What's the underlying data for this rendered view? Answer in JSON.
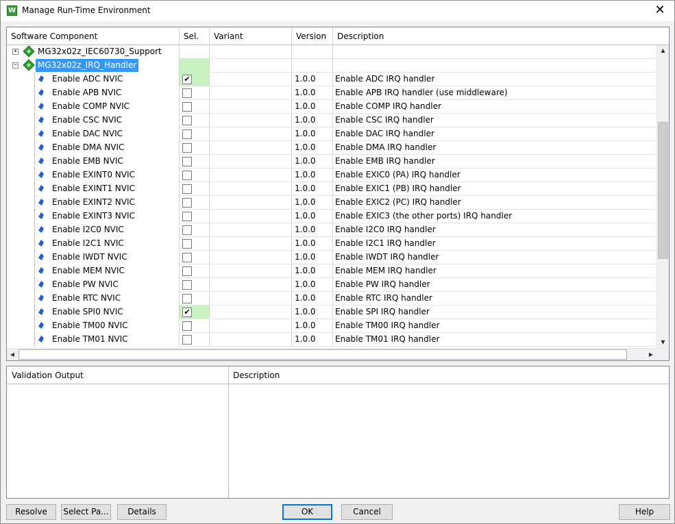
{
  "window": {
    "title": "Manage Run-Time Environment",
    "app_icon_letter": "W",
    "close_glyph": "✕"
  },
  "grid": {
    "columns": {
      "component": "Software Component",
      "sel": "Sel.",
      "variant": "Variant",
      "version": "Version",
      "description": "Description"
    },
    "rows": [
      {
        "type": "bundle",
        "expander": "+",
        "label": "MG32x02z_IEC60730_Support",
        "checked": false,
        "version": "",
        "description": "",
        "highlight": false
      },
      {
        "type": "bundle",
        "expander": "−",
        "label": "MG32x02z_IRQ_Handler",
        "checked": false,
        "version": "",
        "description": "",
        "highlight": true
      },
      {
        "type": "item",
        "label": "Enable ADC NVIC",
        "checked": true,
        "version": "1.0.0",
        "description": "Enable ADC IRQ handler"
      },
      {
        "type": "item",
        "label": "Enable APB NVIC",
        "checked": false,
        "version": "1.0.0",
        "description": "Enable APB IRQ handler (use middleware)"
      },
      {
        "type": "item",
        "label": "Enable COMP NVIC",
        "checked": false,
        "version": "1.0.0",
        "description": "Enable COMP IRQ handler"
      },
      {
        "type": "item",
        "label": "Enable CSC NVIC",
        "checked": false,
        "version": "1.0.0",
        "description": "Enable CSC IRQ handler"
      },
      {
        "type": "item",
        "label": "Enable DAC NVIC",
        "checked": false,
        "version": "1.0.0",
        "description": "Enable DAC IRQ handler"
      },
      {
        "type": "item",
        "label": "Enable DMA NVIC",
        "checked": false,
        "version": "1.0.0",
        "description": "Enable DMA IRQ handler"
      },
      {
        "type": "item",
        "label": "Enable EMB NVIC",
        "checked": false,
        "version": "1.0.0",
        "description": "Enable EMB IRQ handler"
      },
      {
        "type": "item",
        "label": "Enable EXINT0 NVIC",
        "checked": false,
        "version": "1.0.0",
        "description": "Enable EXIC0 (PA) IRQ handler"
      },
      {
        "type": "item",
        "label": "Enable EXINT1 NVIC",
        "checked": false,
        "version": "1.0.0",
        "description": "Enable EXIC1 (PB) IRQ handler"
      },
      {
        "type": "item",
        "label": "Enable EXINT2 NVIC",
        "checked": false,
        "version": "1.0.0",
        "description": "Enable EXIC2 (PC) IRQ handler"
      },
      {
        "type": "item",
        "label": "Enable EXINT3 NVIC",
        "checked": false,
        "version": "1.0.0",
        "description": "Enable EXIC3 (the other ports) IRQ handler"
      },
      {
        "type": "item",
        "label": "Enable I2C0 NVIC",
        "checked": false,
        "version": "1.0.0",
        "description": "Enable I2C0 IRQ handler"
      },
      {
        "type": "item",
        "label": "Enable I2C1 NVIC",
        "checked": false,
        "version": "1.0.0",
        "description": "Enable I2C1 IRQ handler"
      },
      {
        "type": "item",
        "label": "Enable IWDT NVIC",
        "checked": false,
        "version": "1.0.0",
        "description": "Enable IWDT IRQ handler"
      },
      {
        "type": "item",
        "label": "Enable MEM NVIC",
        "checked": false,
        "version": "1.0.0",
        "description": "Enable MEM IRQ handler"
      },
      {
        "type": "item",
        "label": "Enable PW NVIC",
        "checked": false,
        "version": "1.0.0",
        "description": "Enable PW IRQ handler"
      },
      {
        "type": "item",
        "label": "Enable RTC NVIC",
        "checked": false,
        "version": "1.0.0",
        "description": "Enable RTC IRQ handler"
      },
      {
        "type": "item",
        "label": "Enable SPI0 NVIC",
        "checked": true,
        "version": "1.0.0",
        "description": "Enable SPI IRQ handler"
      },
      {
        "type": "item",
        "label": "Enable TM00 NVIC",
        "checked": false,
        "version": "1.0.0",
        "description": "Enable TM00 IRQ handler"
      },
      {
        "type": "item",
        "label": "Enable TM01 NVIC",
        "checked": false,
        "version": "1.0.0",
        "description": "Enable TM01 IRQ handler"
      }
    ],
    "check_glyph": "✔",
    "scroll_up_glyph": "▲",
    "scroll_down_glyph": "▼",
    "scroll_left_glyph": "◀",
    "scroll_right_glyph": "▶"
  },
  "validation": {
    "col_output": "Validation Output",
    "col_description": "Description"
  },
  "buttons": {
    "resolve": "Resolve",
    "select_packs": "Select Pa...",
    "details": "Details",
    "ok": "OK",
    "cancel": "Cancel",
    "help": "Help"
  },
  "colors": {
    "selection_blue": "#3399ff",
    "sel_green": "#c8f2c0",
    "component_diamond": "#2fa52f",
    "component_gem": "#1f5fd6"
  }
}
